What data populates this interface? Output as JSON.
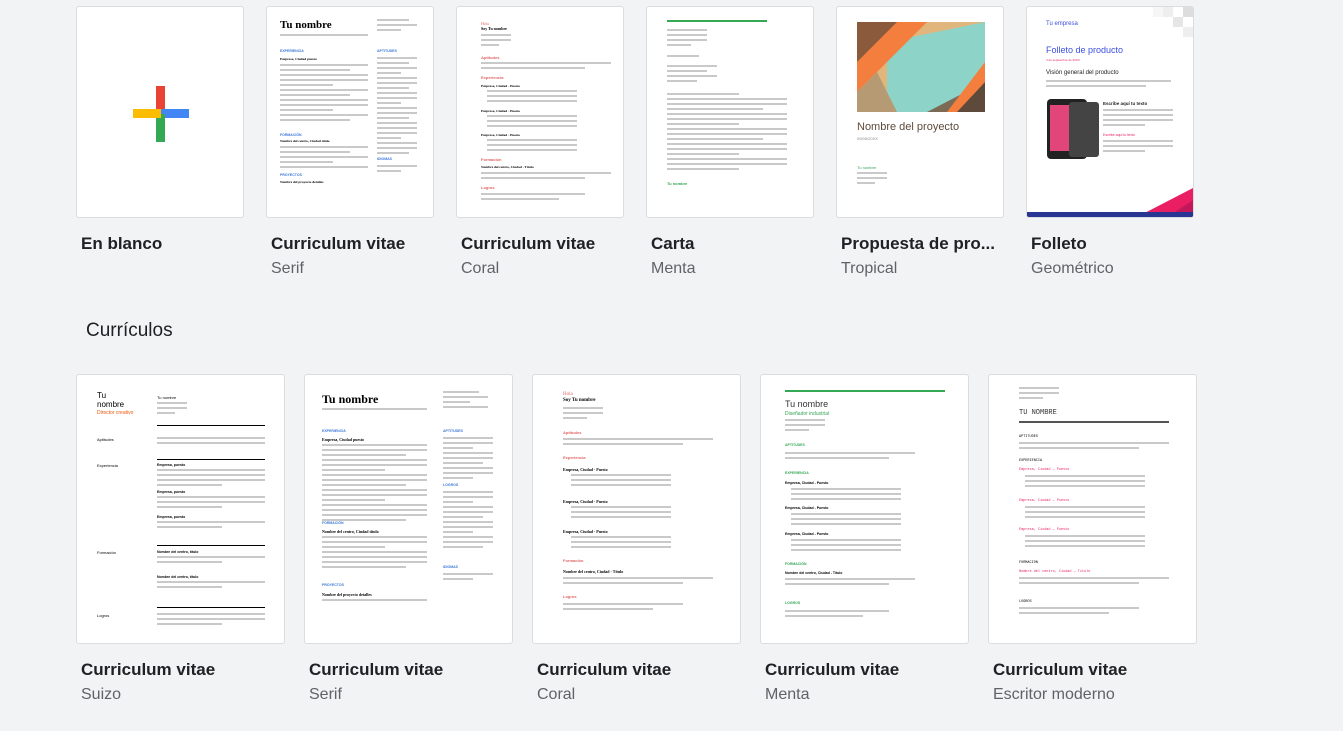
{
  "templates_top": [
    {
      "title": "En blanco",
      "subtitle": ""
    },
    {
      "title": "Curriculum vitae",
      "subtitle": "Serif"
    },
    {
      "title": "Curriculum vitae",
      "subtitle": "Coral"
    },
    {
      "title": "Carta",
      "subtitle": "Menta"
    },
    {
      "title": "Propuesta de pro...",
      "subtitle": "Tropical"
    },
    {
      "title": "Folleto",
      "subtitle": "Geométrico"
    }
  ],
  "section_curriculos": {
    "title": "Currículos"
  },
  "templates_curriculos": [
    {
      "title": "Curriculum vitae",
      "subtitle": "Suizo"
    },
    {
      "title": "Curriculum vitae",
      "subtitle": "Serif"
    },
    {
      "title": "Curriculum vitae",
      "subtitle": "Coral"
    },
    {
      "title": "Curriculum vitae",
      "subtitle": "Menta"
    },
    {
      "title": "Curriculum vitae",
      "subtitle": "Escritor moderno"
    }
  ],
  "previews": {
    "serif": {
      "name": "Tu nombre",
      "sec1": "EXPERIENCIA",
      "sec2": "FORMACIÓN",
      "sec3": "PROYECTOS",
      "side1": "APTITUDES",
      "side2": "LOGROS",
      "side3": "IDIOMAS",
      "job": "Empresa, Ciudad  puesto",
      "school": "Nombre del centro, Ciudad  título",
      "project": "Nombre del proyecto  detalles"
    },
    "coral": {
      "hello": "Hola",
      "name": "Soy Tu nombre",
      "sec1": "Aptitudes",
      "sec2": "Experiencia",
      "sec3": "Formación",
      "sec4": "Logros",
      "job": "Empresa, Ciudad - Puesto",
      "school": "Nombre del centro, Ciudad - Título"
    },
    "carta": {
      "signature": "Tu nombre"
    },
    "tropical": {
      "project_title": "Nombre del proyecto",
      "date": "09/05/20XX",
      "name": "Tu nombre"
    },
    "folleto": {
      "company": "Tu empresa",
      "title": "Folleto de producto",
      "date": "4 de septiembre de 20XX",
      "overview": "Visión general del producto",
      "write_here": "Escribe aquí tu texto"
    },
    "suizo": {
      "name_line1": "Tu",
      "name_line2": "nombre",
      "contact_name": "Tu nombre",
      "role": "Director creativo",
      "sec1": "Aptitudes",
      "sec2": "Experiencia",
      "sec3": "Formación",
      "sec4": "Logros",
      "job": "Empresa, puesto",
      "school": "Nombre del centro, título"
    },
    "menta": {
      "name": "Tu nombre",
      "role": "Diseñador industrial",
      "sec1": "APTITUDES",
      "sec2": "EXPERIENCIA",
      "sec3": "FORMACIÓN",
      "sec4": "LOGROS",
      "job": "Empresa, Ciudad - Puesto",
      "school": "Nombre del centro, Ciudad - Título"
    },
    "moderno": {
      "name": "TU NOMBRE",
      "sec1": "APTITUDES",
      "sec2": "EXPERIENCIA",
      "sec3": "FORMACIÓN",
      "sec4": "LOGROS",
      "job": "Empresa, Ciudad — Puesto",
      "school": "Nombre del centro, Ciudad — Título"
    }
  },
  "colors": {
    "accent_blue": "#4285f4",
    "accent_red": "#ea4335",
    "accent_green": "#34a853",
    "accent_yellow": "#fbbc04",
    "coral": "#e06666",
    "mint": "#34a853"
  }
}
